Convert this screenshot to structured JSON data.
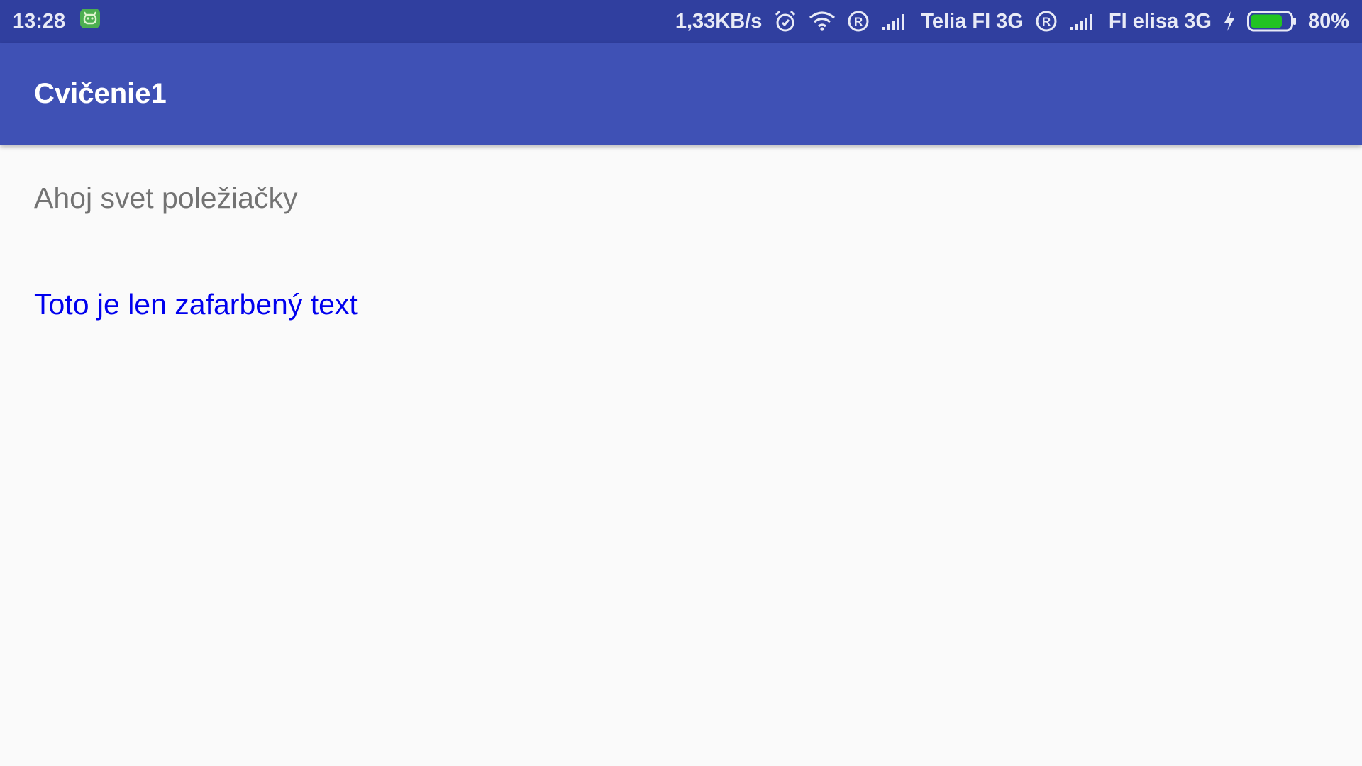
{
  "status_bar": {
    "time": "13:28",
    "net_speed": "1,33KB/s",
    "carrier1": "Telia FI 3G",
    "carrier2": "FI elisa 3G",
    "battery": "80%",
    "battery_level": 0.8,
    "colors": {
      "background": "#303f9f",
      "battery_fill": "#22c322",
      "android_icon": "#4caf50"
    },
    "icons": [
      "android-notification-icon",
      "alarm-icon",
      "wifi-icon",
      "roaming-r-icon",
      "signal-icon",
      "roaming-r-icon",
      "signal-icon",
      "charging-bolt-icon",
      "battery-icon"
    ]
  },
  "app_bar": {
    "title": "Cvičenie1",
    "color": "#3f51b5"
  },
  "content": {
    "text1": "Ahoj svet poležiačky",
    "text1_color": "#737373",
    "text2": "Toto je len zafarbený text",
    "text2_color": "#0000ee"
  }
}
